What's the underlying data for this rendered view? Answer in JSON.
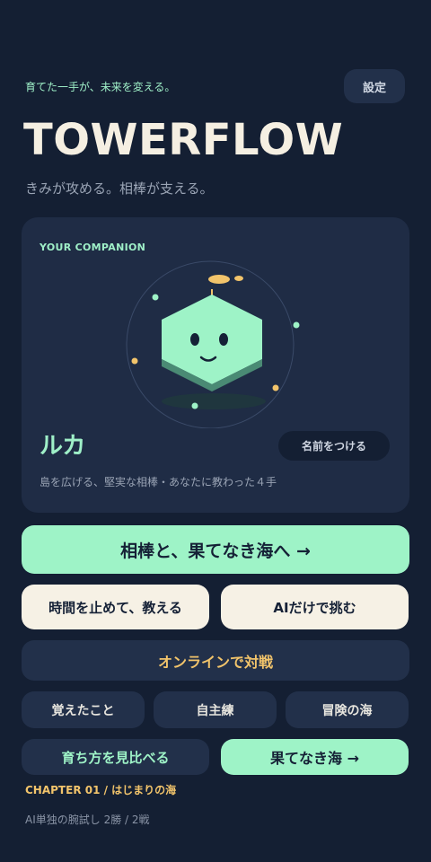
{
  "header": {
    "tagline": "育てた一手が、未来を変える。",
    "settings_label": "設定",
    "title": "TOWERFLOW",
    "subtitle": "きみが攻める。相棒が支える。"
  },
  "companion": {
    "section_label": "YOUR COMPANION",
    "name": "ルカ",
    "name_button_label": "名前をつける",
    "description": "島を広げる、堅実な相棒・あなたに教わった４手"
  },
  "actions": {
    "primary_label": "相棒と、果てなき海へ →",
    "pause_teach_label": "時間を止めて、教える",
    "ai_only_label": "AIだけで挑む",
    "online_label": "オンラインで対戦",
    "learned_label": "覚えたこと",
    "self_practice_label": "自主練",
    "adventure_label": "冒険の海",
    "compare_label": "育ち方を見比べる",
    "endless_label": "果てなき海 →"
  },
  "progress": {
    "chapter_text": "CHAPTER 01 / はじまりの海",
    "record_text": "AI単独の腕試し 2勝 / 2戦"
  },
  "colors": {
    "background": "#141f33",
    "accent_mint": "#9ef3c7",
    "accent_gold": "#f2c46b",
    "card": "#1f2c45",
    "cream": "#f6f1e5"
  }
}
